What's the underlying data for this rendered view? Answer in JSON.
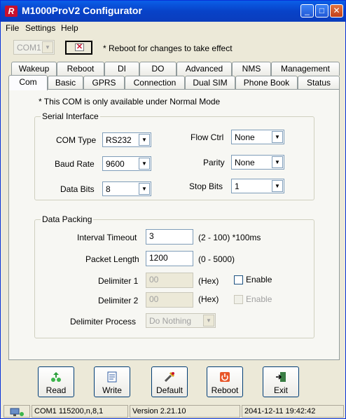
{
  "window": {
    "title": "M1000ProV2 Configurator",
    "icon": "R"
  },
  "titlebar_buttons": {
    "minimize": "_",
    "maximize": "□",
    "close": "✕"
  },
  "menu": [
    "File",
    "Settings",
    "Help"
  ],
  "toolbar": {
    "port_value": "COM1",
    "notice": "* Reboot for changes to take effect"
  },
  "tabs_row1": [
    "Wakeup",
    "Reboot",
    "DI",
    "DO",
    "Advanced",
    "NMS",
    "Management"
  ],
  "tabs_row2": [
    "Com",
    "Basic",
    "GPRS",
    "Connection",
    "Dual SIM",
    "Phone Book",
    "Status"
  ],
  "active_tab": "Com",
  "com": {
    "note": "* This COM is only available under Normal Mode",
    "serial": {
      "title": "Serial Interface",
      "com_type_label": "COM Type",
      "com_type": "RS232",
      "baud_rate_label": "Baud Rate",
      "baud_rate": "9600",
      "data_bits_label": "Data Bits",
      "data_bits": "8",
      "flow_ctrl_label": "Flow Ctrl",
      "flow_ctrl": "None",
      "parity_label": "Parity",
      "parity": "None",
      "stop_bits_label": "Stop Bits",
      "stop_bits": "1"
    },
    "packing": {
      "title": "Data Packing",
      "interval_timeout_label": "Interval Timeout",
      "interval_timeout": "3",
      "interval_timeout_hint": "(2 - 100) *100ms",
      "packet_length_label": "Packet Length",
      "packet_length": "1200",
      "packet_length_hint": "(0 - 5000)",
      "delimiter1_label": "Delimiter 1",
      "delimiter1": "00",
      "delimiter1_hint": "(Hex)",
      "enable1_label": "Enable",
      "delimiter2_label": "Delimiter 2",
      "delimiter2": "00",
      "delimiter2_hint": "(Hex)",
      "enable2_label": "Enable",
      "delimiter_process_label": "Delimiter Process",
      "delimiter_process": "Do Nothing"
    }
  },
  "actions": [
    {
      "label": "Read",
      "icon": "read-icon"
    },
    {
      "label": "Write",
      "icon": "write-icon"
    },
    {
      "label": "Default",
      "icon": "default-icon"
    },
    {
      "label": "Reboot",
      "icon": "reboot-icon"
    },
    {
      "label": "Exit",
      "icon": "exit-icon"
    }
  ],
  "status": {
    "port": "COM1 115200,n,8,1",
    "version": "Version 2.21.10",
    "datetime": "2041-12-11 19:42:42"
  },
  "colors": {
    "title_bar": "#0a5fe8",
    "close_button": "#d4522a",
    "brand_red": "#c8102e"
  }
}
